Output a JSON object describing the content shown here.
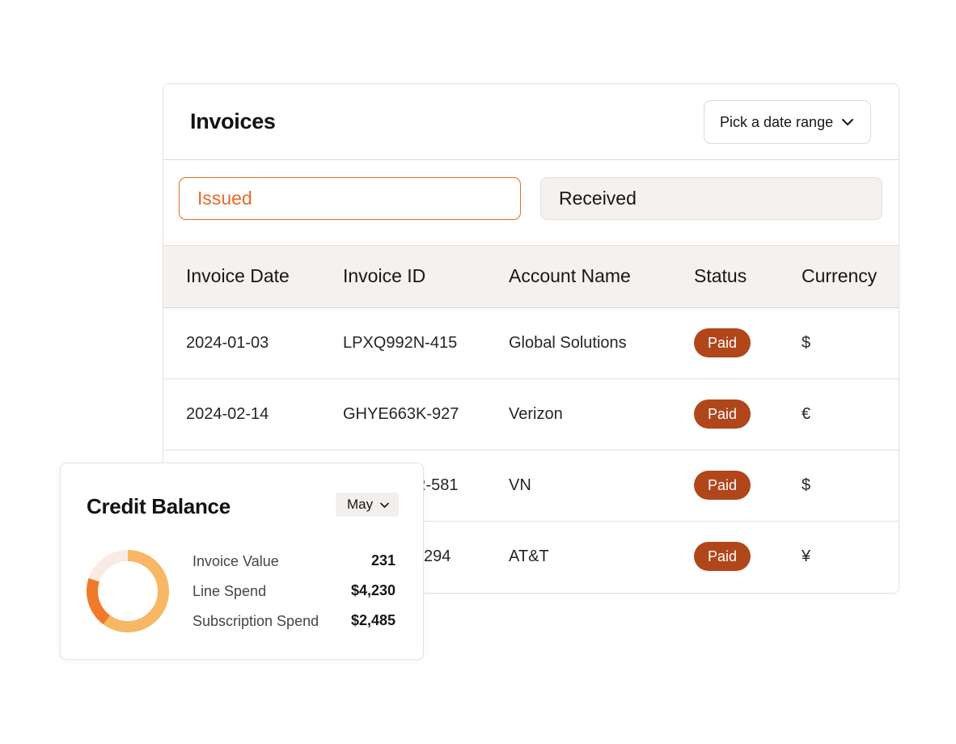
{
  "invoices": {
    "title": "Invoices",
    "date_range_label": "Pick a date range",
    "tabs": [
      {
        "label": "Issued",
        "active": true
      },
      {
        "label": "Received",
        "active": false
      }
    ],
    "columns": [
      "Invoice Date",
      "Invoice ID",
      "Account Name",
      "Status",
      "Currency"
    ],
    "rows": [
      {
        "date": "2024-01-03",
        "id": "LPXQ992N-415",
        "account": "Global Solutions",
        "status": "Paid",
        "currency": "$"
      },
      {
        "date": "2024-02-14",
        "id": "GHYE663K-927",
        "account": "Verizon",
        "status": "Paid",
        "currency": "€"
      },
      {
        "date": "",
        "id": "R-581",
        "account": "VN",
        "status": "Paid",
        "currency": "$"
      },
      {
        "date": "",
        "id": "294",
        "account": "AT&T",
        "status": "Paid",
        "currency": "¥"
      }
    ]
  },
  "credit_balance": {
    "title": "Credit Balance",
    "month": "May",
    "metrics": [
      {
        "label": "Invoice Value",
        "value": "231"
      },
      {
        "label": "Line Spend",
        "value": "$4,230"
      },
      {
        "label": "Subscription Spend",
        "value": "$2,485"
      }
    ],
    "donut": {
      "segments": [
        {
          "name": "light",
          "color": "#f7b764",
          "fraction": 0.6
        },
        {
          "name": "dark",
          "color": "#f07a2a",
          "fraction": 0.2
        },
        {
          "name": "track",
          "color": "#f8ebe4",
          "fraction": 0.2
        }
      ]
    }
  },
  "colors": {
    "accent": "#e86a22",
    "badge": "#b0461a",
    "header_bg": "#f4f1ef"
  },
  "icons": {
    "date_chevron": "chevron-down-icon",
    "month_chevron": "chevron-down-icon"
  }
}
